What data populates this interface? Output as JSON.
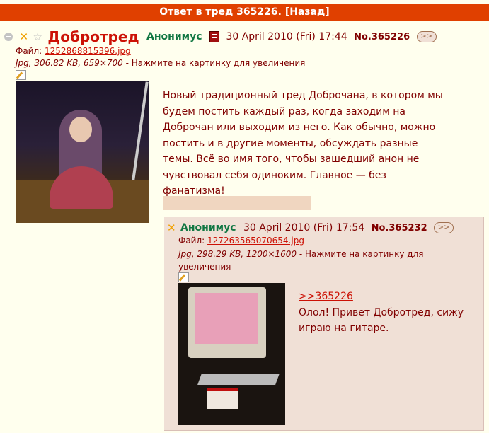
{
  "banner": {
    "text": "Ответ в тред 365226.",
    "bracket_open": "[",
    "back_label": "Назад",
    "bracket_close": "]"
  },
  "op": {
    "subject": "Добротред",
    "name": "Анонимус",
    "date": "30 April 2010 (Fri) 17:44",
    "postnum": "No.365226",
    "file_label": "Файл:",
    "file_name": "1252868815396.jpg",
    "file_meta": "Jpg, 306.82 KB, 659×700",
    "file_hint": " - Нажмите на картинку для увеличения",
    "message": "Новый традиционный тред Доброчана, в котором мы будем постить каждый раз, когда заходим на Доброчан или выходим из него. Как обычно, можно постить и в другие моменты, обсуждать разные темы. Всё во имя того, чтобы зашедший анон не чувствовал себя одиноким. Главное — без фанатизма!"
  },
  "reply": {
    "name": "Анонимус",
    "date": "30 April 2010 (Fri) 17:54",
    "postnum": "No.365232",
    "file_label": "Файл:",
    "file_name": "127263565070654.jpg",
    "file_meta": "Jpg, 298.29 KB, 1200×1600",
    "file_hint": " - Нажмите на картинку для увеличения",
    "quote_link": ">>365226",
    "message": "Олол! Привет Добротред, сижу играю на гитаре."
  },
  "icons": {
    "hide": "minus-circle-icon",
    "delete": "x-icon",
    "favorite": "star-icon",
    "sage": "book-icon",
    "reply": "reply-arrow-icon",
    "edit": "edit-icon"
  },
  "colors": {
    "banner": "#e04000",
    "background": "#ffffee",
    "reply_bg": "#f0e0d6",
    "subject": "#cc1105",
    "name": "#117743"
  }
}
